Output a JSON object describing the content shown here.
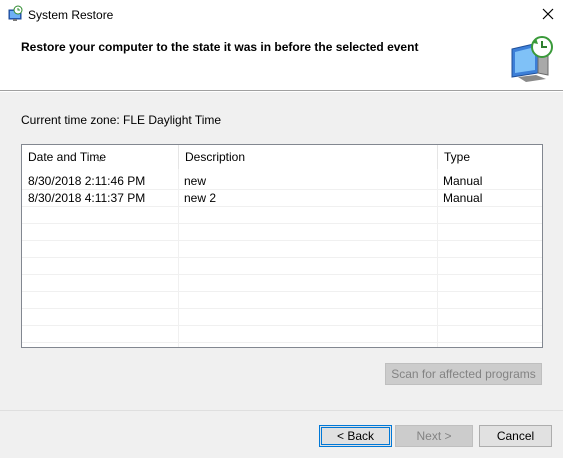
{
  "window": {
    "title": "System Restore",
    "app_icon": "system-restore-icon",
    "close_icon": "close-icon"
  },
  "header": {
    "title": "Restore your computer to the state it was in before the selected event",
    "icon": "monitor-restore-icon"
  },
  "timezone": {
    "label": "Current time zone: FLE Daylight Time"
  },
  "table": {
    "columns": [
      "Date and Time",
      "Description",
      "Type"
    ],
    "sort_icon": "sort-descending-icon",
    "rows": [
      [
        "8/30/2018 2:11:46 PM",
        "new",
        "Manual"
      ],
      [
        "8/30/2018 4:11:37 PM",
        "new 2",
        "Manual"
      ]
    ]
  },
  "buttons": {
    "scan": "Scan for affected programs",
    "back": "< Back",
    "next": "Next >",
    "cancel": "Cancel"
  },
  "colors": {
    "accent": "#0078d7",
    "panel": "#f0f0f0"
  }
}
